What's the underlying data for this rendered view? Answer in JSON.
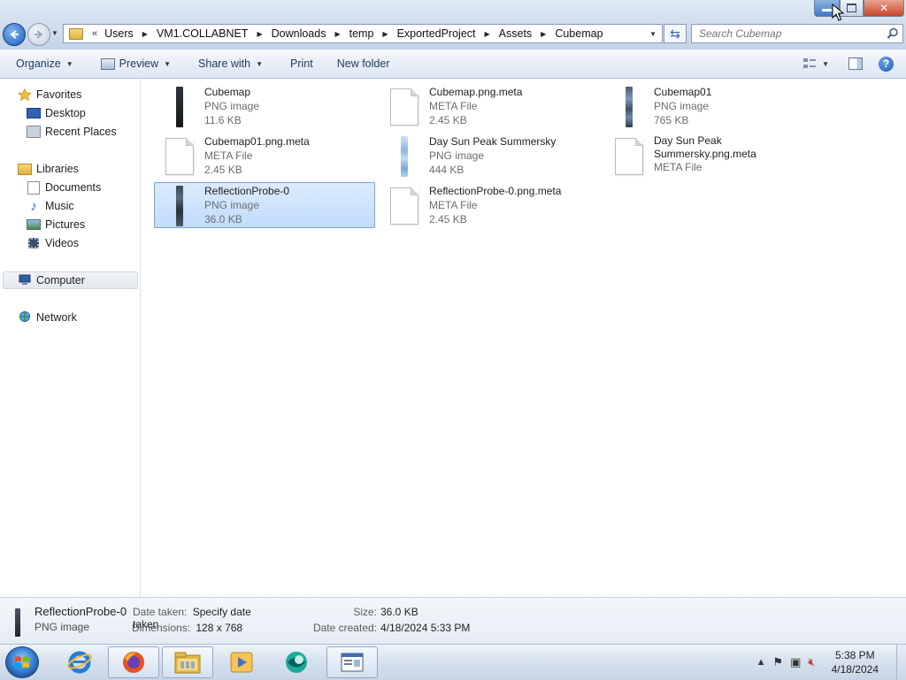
{
  "window": {
    "caption_buttons": {
      "minimize": "minimize",
      "maximize": "restore",
      "close": "close"
    }
  },
  "address": {
    "overflow": "«",
    "crumbs": [
      "Users",
      "VM1.COLLABNET",
      "Downloads",
      "temp",
      "ExportedProject",
      "Assets",
      "Cubemap"
    ]
  },
  "search": {
    "placeholder": "Search Cubemap"
  },
  "toolbar": {
    "organize": "Organize",
    "preview": "Preview",
    "share_with": "Share with",
    "print": "Print",
    "new_folder": "New folder"
  },
  "nav": {
    "favorites": "Favorites",
    "desktop": "Desktop",
    "recent_places": "Recent Places",
    "libraries": "Libraries",
    "documents": "Documents",
    "music": "Music",
    "pictures": "Pictures",
    "videos": "Videos",
    "computer": "Computer",
    "network": "Network"
  },
  "files": [
    {
      "name": "Cubemap",
      "type": "PNG image",
      "size": "11.6 KB",
      "icon": "png-strip-dark",
      "color": "#1f2428"
    },
    {
      "name": "Cubemap.png.meta",
      "type": "META File",
      "size": "2.45 KB",
      "icon": "document-icon"
    },
    {
      "name": "Cubemap01",
      "type": "PNG image",
      "size": "765 KB",
      "icon": "png-strip-blue",
      "color": "#5f7a93"
    },
    {
      "name": "Cubemap01.png.meta",
      "type": "META File",
      "size": "2.45 KB",
      "icon": "document-icon"
    },
    {
      "name": "Day Sun Peak Summersky",
      "type": "PNG image",
      "size": "444 KB",
      "icon": "png-strip-sky",
      "color": "#9fc3e2"
    },
    {
      "name": "Day Sun Peak Summersky.png.meta",
      "type": "META File",
      "size": "",
      "icon": "document-icon"
    },
    {
      "name": "ReflectionProbe-0",
      "type": "PNG image",
      "size": "36.0 KB",
      "icon": "png-strip-gray",
      "color": "#3a4652",
      "selected": true
    },
    {
      "name": "ReflectionProbe-0.png.meta",
      "type": "META File",
      "size": "2.45 KB",
      "icon": "document-icon"
    }
  ],
  "details": {
    "name": "ReflectionProbe-0",
    "type": "PNG image",
    "date_taken_label": "Date taken:",
    "date_taken_value": "Specify date taken",
    "dimensions_label": "Dimensions:",
    "dimensions_value": "128 x 768",
    "size_label": "Size:",
    "size_value": "36.0 KB",
    "date_created_label": "Date created:",
    "date_created_value": "4/18/2024 5:33 PM"
  },
  "taskbar": {
    "apps": [
      "internet-explorer-icon",
      "firefox-icon",
      "explorer-icon",
      "media-player-icon",
      "browser-icon",
      "document-window-icon"
    ],
    "time": "5:38 PM",
    "date": "4/18/2024"
  },
  "colors": {
    "accent": "#3067b8",
    "selection": "#c1dcfc"
  }
}
